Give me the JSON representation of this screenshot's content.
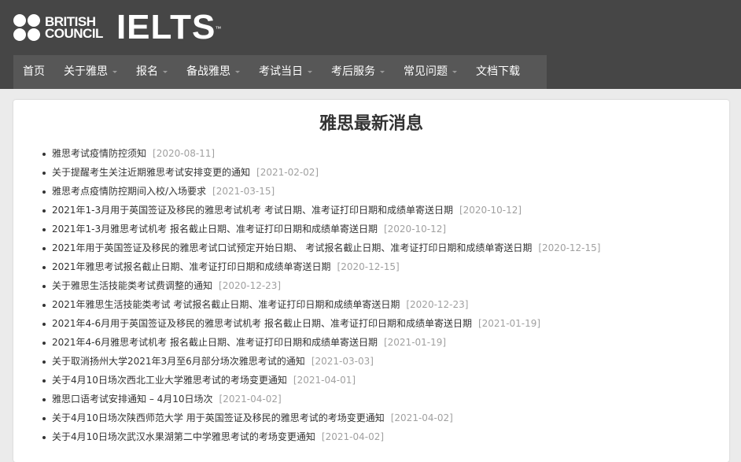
{
  "brand": {
    "bc_line1": "BRITISH",
    "bc_line2": "COUNCIL",
    "ielts": "IELTS",
    "tm": "™"
  },
  "nav": {
    "items": [
      {
        "label": "首页",
        "has_dropdown": false
      },
      {
        "label": "关于雅思",
        "has_dropdown": true
      },
      {
        "label": "报名",
        "has_dropdown": true
      },
      {
        "label": "备战雅思",
        "has_dropdown": true
      },
      {
        "label": "考试当日",
        "has_dropdown": true
      },
      {
        "label": "考后服务",
        "has_dropdown": true
      },
      {
        "label": "常见问题",
        "has_dropdown": true
      },
      {
        "label": "文档下载",
        "has_dropdown": false
      }
    ]
  },
  "main": {
    "title": "雅思最新消息",
    "news": [
      {
        "title": "雅思考试疫情防控须知",
        "date": "[2020-08-11]"
      },
      {
        "title": "关于提醒考生关注近期雅思考试安排变更的通知",
        "date": "[2021-02-02]"
      },
      {
        "title": "雅思考点疫情防控期间入校/入场要求",
        "date": "[2021-03-15]"
      },
      {
        "title": "2021年1-3月用于英国签证及移民的雅思考试机考 考试日期、准考证打印日期和成绩单寄送日期",
        "date": "[2020-10-12]"
      },
      {
        "title": "2021年1-3月雅思考试机考 报名截止日期、准考证打印日期和成绩单寄送日期",
        "date": "[2020-10-12]"
      },
      {
        "title": "2021年用于英国签证及移民的雅思考试口试预定开始日期、 考试报名截止日期、准考证打印日期和成绩单寄送日期",
        "date": "[2020-12-15]"
      },
      {
        "title": "2021年雅思考试报名截止日期、准考证打印日期和成绩单寄送日期",
        "date": "[2020-12-15]"
      },
      {
        "title": "关于雅思生活技能类考试费调整的通知",
        "date": "[2020-12-23]"
      },
      {
        "title": "2021年雅思生活技能类考试 考试报名截止日期、准考证打印日期和成绩单寄送日期",
        "date": "[2020-12-23]"
      },
      {
        "title": "2021年4-6月用于英国签证及移民的雅思考试机考 报名截止日期、准考证打印日期和成绩单寄送日期",
        "date": "[2021-01-19]"
      },
      {
        "title": "2021年4-6月雅思考试机考 报名截止日期、准考证打印日期和成绩单寄送日期",
        "date": "[2021-01-19]"
      },
      {
        "title": "关于取消扬州大学2021年3月至6月部分场次雅思考试的通知",
        "date": "[2021-03-03]"
      },
      {
        "title": "关于4月10日场次西北工业大学雅思考试的考场变更通知",
        "date": "[2021-04-01]"
      },
      {
        "title": "雅思口语考试安排通知 – 4月10日场次",
        "date": "[2021-04-02]"
      },
      {
        "title": "关于4月10日场次陕西师范大学 用于英国签证及移民的雅思考试的考场变更通知",
        "date": "[2021-04-02]"
      },
      {
        "title": "关于4月10日场次武汉水果湖第二中学雅思考试的考场变更通知",
        "date": "[2021-04-02]"
      }
    ]
  },
  "colors": {
    "header_bg": "#464646",
    "nav_bg": "#575757",
    "date_gray": "#a0a0a0"
  }
}
